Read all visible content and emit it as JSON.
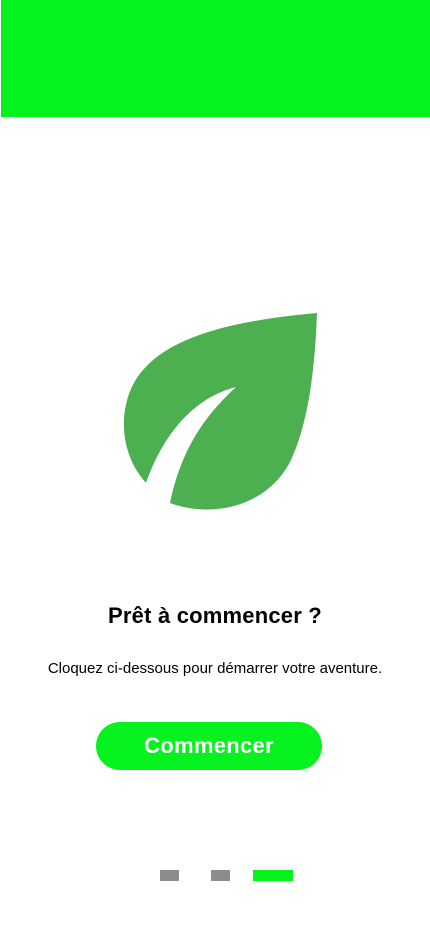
{
  "colors": {
    "accent": "#06F21E",
    "leaf": "#4CAF50",
    "inactive_dot": "#8C8C8C",
    "background": "#FFFFFF"
  },
  "header": {
    "banner_color": "#06F21E"
  },
  "illustration": {
    "icon": "leaf-icon"
  },
  "content": {
    "title": "Prêt à commencer ?",
    "subtitle": "Cloquez ci-dessous pour démarrer votre aventure.",
    "start_label": "Commencer"
  },
  "pager": {
    "total": 3,
    "current": 3
  }
}
